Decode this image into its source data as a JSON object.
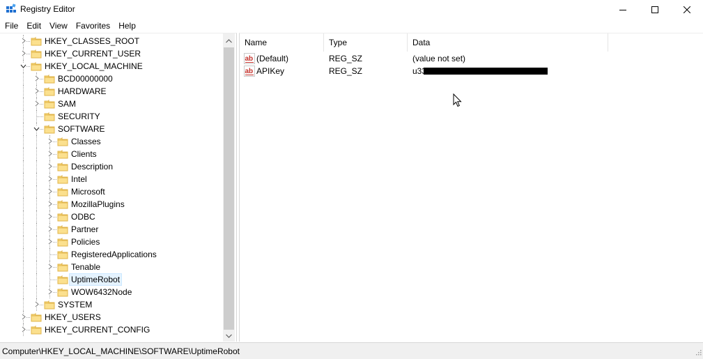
{
  "window": {
    "title": "Registry Editor",
    "icon": "registry-editor-icon",
    "controls": [
      "minimize",
      "maximize",
      "close"
    ]
  },
  "menu": [
    "File",
    "Edit",
    "View",
    "Favorites",
    "Help"
  ],
  "tree": [
    {
      "label": "HKEY_CLASSES_ROOT",
      "depth": 1,
      "expander": "collapsed",
      "selected": false
    },
    {
      "label": "HKEY_CURRENT_USER",
      "depth": 1,
      "expander": "collapsed",
      "selected": false
    },
    {
      "label": "HKEY_LOCAL_MACHINE",
      "depth": 1,
      "expander": "expanded",
      "selected": false
    },
    {
      "label": "BCD00000000",
      "depth": 2,
      "expander": "collapsed",
      "selected": false
    },
    {
      "label": "HARDWARE",
      "depth": 2,
      "expander": "collapsed",
      "selected": false
    },
    {
      "label": "SAM",
      "depth": 2,
      "expander": "collapsed",
      "selected": false
    },
    {
      "label": "SECURITY",
      "depth": 2,
      "expander": "none",
      "selected": false
    },
    {
      "label": "SOFTWARE",
      "depth": 2,
      "expander": "expanded",
      "selected": false
    },
    {
      "label": "Classes",
      "depth": 3,
      "expander": "collapsed",
      "selected": false
    },
    {
      "label": "Clients",
      "depth": 3,
      "expander": "collapsed",
      "selected": false
    },
    {
      "label": "Description",
      "depth": 3,
      "expander": "collapsed",
      "selected": false
    },
    {
      "label": "Intel",
      "depth": 3,
      "expander": "collapsed",
      "selected": false
    },
    {
      "label": "Microsoft",
      "depth": 3,
      "expander": "collapsed",
      "selected": false
    },
    {
      "label": "MozillaPlugins",
      "depth": 3,
      "expander": "collapsed",
      "selected": false
    },
    {
      "label": "ODBC",
      "depth": 3,
      "expander": "collapsed",
      "selected": false
    },
    {
      "label": "Partner",
      "depth": 3,
      "expander": "collapsed",
      "selected": false
    },
    {
      "label": "Policies",
      "depth": 3,
      "expander": "collapsed",
      "selected": false
    },
    {
      "label": "RegisteredApplications",
      "depth": 3,
      "expander": "none",
      "selected": false
    },
    {
      "label": "Tenable",
      "depth": 3,
      "expander": "collapsed",
      "selected": false
    },
    {
      "label": "UptimeRobot",
      "depth": 3,
      "expander": "none",
      "selected": true
    },
    {
      "label": "WOW6432Node",
      "depth": 3,
      "expander": "collapsed",
      "selected": false
    },
    {
      "label": "SYSTEM",
      "depth": 2,
      "expander": "collapsed",
      "selected": false
    },
    {
      "label": "HKEY_USERS",
      "depth": 1,
      "expander": "collapsed",
      "selected": false
    },
    {
      "label": "HKEY_CURRENT_CONFIG",
      "depth": 1,
      "expander": "collapsed",
      "selected": false
    }
  ],
  "columns": [
    "Name",
    "Type",
    "Data"
  ],
  "values": [
    {
      "name": "(Default)",
      "type": "REG_SZ",
      "data": "(value not set)",
      "icon": "string-value-icon",
      "redacted": false
    },
    {
      "name": "APIKey",
      "type": "REG_SZ",
      "data": "u33",
      "icon": "string-value-icon",
      "redacted": true
    }
  ],
  "status": "Computer\\HKEY_LOCAL_MACHINE\\SOFTWARE\\UptimeRobot",
  "colors": {
    "selection_bg": "#e5f3ff",
    "folder": "#f8d775",
    "folder_edge": "#e0b44a",
    "status_bg": "#f0f0f0"
  }
}
